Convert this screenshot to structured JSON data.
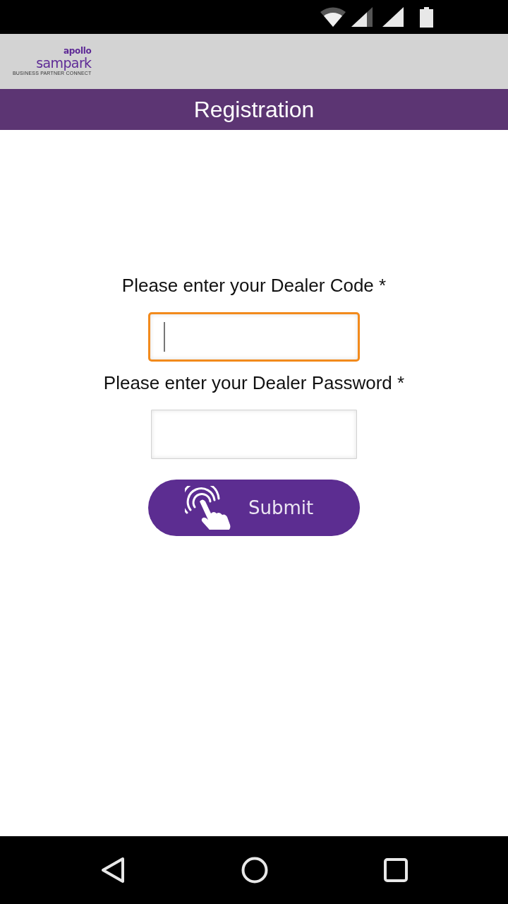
{
  "header": {
    "logo": {
      "brand": "apollo",
      "name": "sampark",
      "tagline": "BUSINESS PARTNER CONNECT"
    }
  },
  "title_bar": {
    "title": "Registration"
  },
  "form": {
    "fields": [
      {
        "label": "Please enter your Dealer Code *",
        "focused": true
      },
      {
        "label": "Please enter your Dealer Password *",
        "focused": false
      }
    ],
    "submit": {
      "label": "Submit"
    }
  }
}
